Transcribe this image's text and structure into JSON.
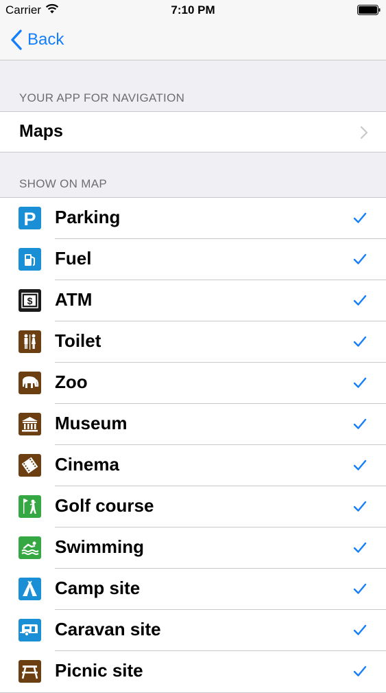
{
  "status_bar": {
    "carrier": "Carrier",
    "time": "7:10 PM"
  },
  "nav": {
    "back_label": "Back"
  },
  "sections": {
    "navigation_header": "YOUR APP FOR NAVIGATION",
    "navigation_app": "Maps",
    "show_header": "SHOW ON MAP"
  },
  "poi_items": [
    {
      "label": "Parking",
      "icon": "parking-icon",
      "color": "#1b8fd6",
      "checked": true
    },
    {
      "label": "Fuel",
      "icon": "fuel-icon",
      "color": "#1b8fd6",
      "checked": true
    },
    {
      "label": "ATM",
      "icon": "atm-icon",
      "color": "#1a1a1a",
      "checked": true
    },
    {
      "label": "Toilet",
      "icon": "toilet-icon",
      "color": "#6b3f12",
      "checked": true
    },
    {
      "label": "Zoo",
      "icon": "elephant-icon",
      "color": "#6b3f12",
      "checked": true
    },
    {
      "label": "Museum",
      "icon": "museum-icon",
      "color": "#6b3f12",
      "checked": true
    },
    {
      "label": "Cinema",
      "icon": "cinema-icon",
      "color": "#6b3f12",
      "checked": true
    },
    {
      "label": "Golf course",
      "icon": "golf-icon",
      "color": "#36a843",
      "checked": true
    },
    {
      "label": "Swimming",
      "icon": "swimming-icon",
      "color": "#36a843",
      "checked": true
    },
    {
      "label": "Camp site",
      "icon": "tent-icon",
      "color": "#1b8fd6",
      "checked": true
    },
    {
      "label": "Caravan site",
      "icon": "caravan-icon",
      "color": "#1b8fd6",
      "checked": true
    },
    {
      "label": "Picnic site",
      "icon": "picnic-table-icon",
      "color": "#6b3f12",
      "checked": true
    }
  ],
  "colors": {
    "accent": "#147efb",
    "check": "#147efb"
  }
}
